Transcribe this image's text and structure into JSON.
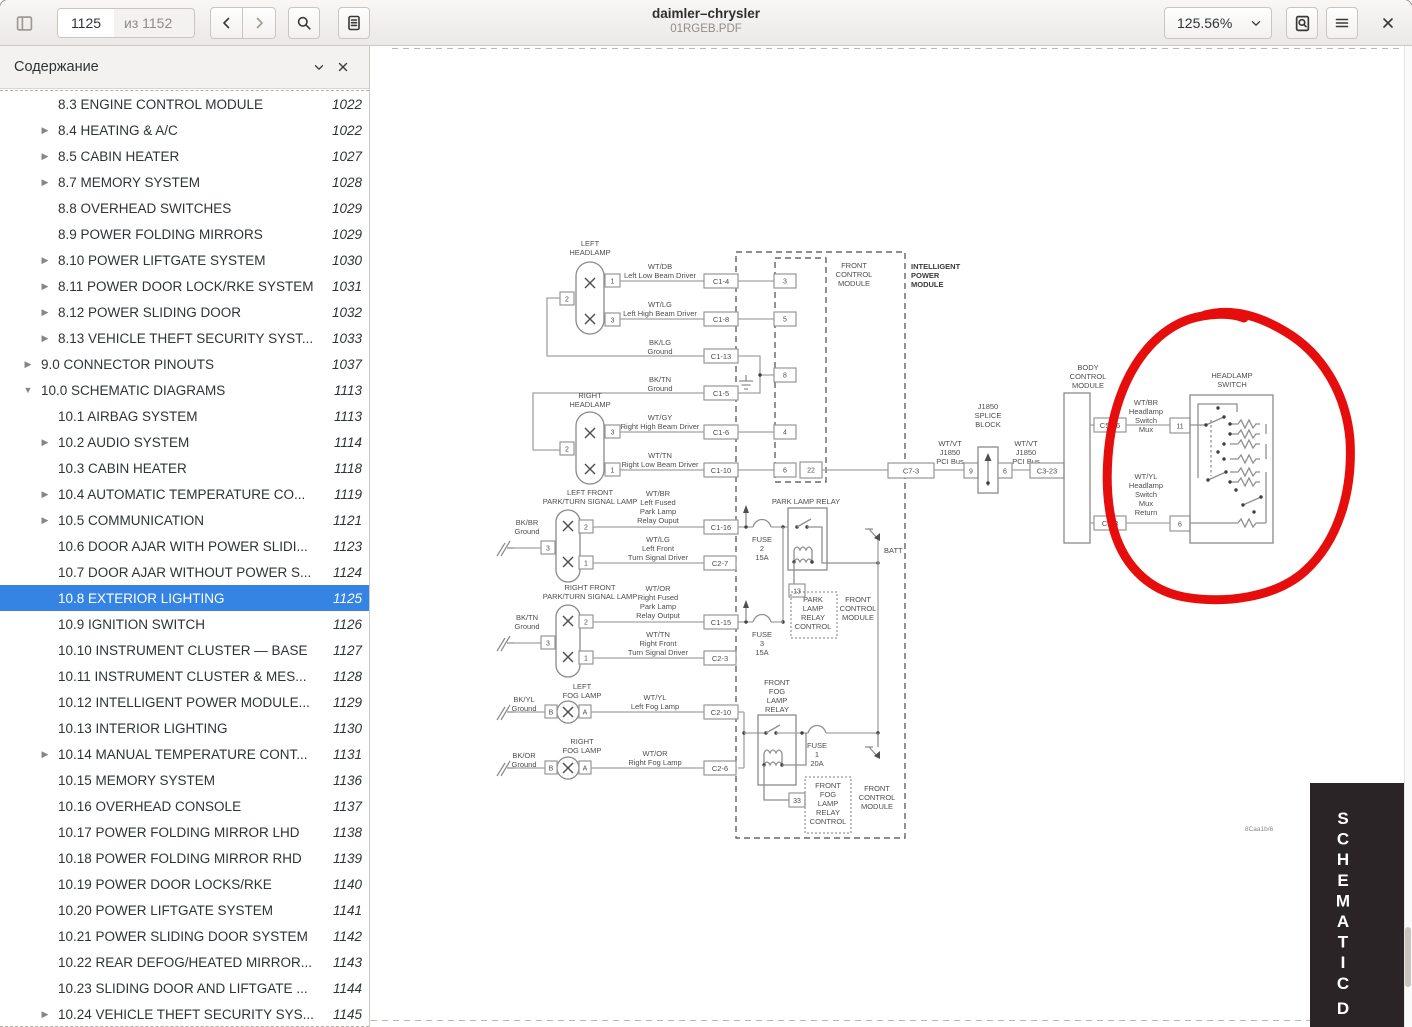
{
  "window": {
    "title": "daimler–chrysler",
    "subtitle": "01RGEB.PDF"
  },
  "toolbar": {
    "page_current": "1125",
    "page_total_label": "из 1152",
    "zoom_level": "125.56%"
  },
  "sidebar": {
    "header": "Содержание",
    "items": [
      {
        "label": "8.3 ENGINE CONTROL MODULE",
        "page": "1022",
        "exp": "none",
        "level": 2,
        "selected": false
      },
      {
        "label": "8.4 HEATING & A/C",
        "page": "1022",
        "exp": "right",
        "level": 2,
        "selected": false
      },
      {
        "label": "8.5 CABIN HEATER",
        "page": "1027",
        "exp": "right",
        "level": 2,
        "selected": false
      },
      {
        "label": "8.7 MEMORY SYSTEM",
        "page": "1028",
        "exp": "right",
        "level": 2,
        "selected": false
      },
      {
        "label": "8.8 OVERHEAD SWITCHES",
        "page": "1029",
        "exp": "none",
        "level": 2,
        "selected": false
      },
      {
        "label": "8.9 POWER FOLDING MIRRORS",
        "page": "1029",
        "exp": "none",
        "level": 2,
        "selected": false
      },
      {
        "label": "8.10 POWER LIFTGATE SYSTEM",
        "page": "1030",
        "exp": "right",
        "level": 2,
        "selected": false
      },
      {
        "label": "8.11 POWER DOOR LOCK/RKE SYSTEM",
        "page": "1031",
        "exp": "right",
        "level": 2,
        "selected": false
      },
      {
        "label": "8.12 POWER SLIDING DOOR",
        "page": "1032",
        "exp": "right",
        "level": 2,
        "selected": false
      },
      {
        "label": "8.13 VEHICLE THEFT SECURITY SYST...",
        "page": "1033",
        "exp": "right",
        "level": 2,
        "selected": false
      },
      {
        "label": "9.0 CONNECTOR PINOUTS",
        "page": "1037",
        "exp": "right",
        "level": 1,
        "selected": false
      },
      {
        "label": "10.0 SCHEMATIC DIAGRAMS",
        "page": "1113",
        "exp": "down",
        "level": 1,
        "selected": false
      },
      {
        "label": "10.1 AIRBAG SYSTEM",
        "page": "1113",
        "exp": "none",
        "level": 2,
        "selected": false
      },
      {
        "label": "10.2 AUDIO SYSTEM",
        "page": "1114",
        "exp": "right",
        "level": 2,
        "selected": false
      },
      {
        "label": "10.3 CABIN HEATER",
        "page": "1118",
        "exp": "none",
        "level": 2,
        "selected": false
      },
      {
        "label": "10.4 AUTOMATIC TEMPERATURE CO...",
        "page": "1119",
        "exp": "right",
        "level": 2,
        "selected": false
      },
      {
        "label": "10.5 COMMUNICATION",
        "page": "1121",
        "exp": "right",
        "level": 2,
        "selected": false
      },
      {
        "label": "10.6 DOOR AJAR WITH POWER SLIDI...",
        "page": "1123",
        "exp": "none",
        "level": 2,
        "selected": false
      },
      {
        "label": "10.7 DOOR AJAR WITHOUT POWER S...",
        "page": "1124",
        "exp": "none",
        "level": 2,
        "selected": false
      },
      {
        "label": "10.8 EXTERIOR LIGHTING",
        "page": "1125",
        "exp": "none",
        "level": 2,
        "selected": true
      },
      {
        "label": "10.9 IGNITION SWITCH",
        "page": "1126",
        "exp": "none",
        "level": 2,
        "selected": false
      },
      {
        "label": "10.10 INSTRUMENT CLUSTER — BASE",
        "page": "1127",
        "exp": "none",
        "level": 2,
        "selected": false
      },
      {
        "label": "10.11 INSTRUMENT CLUSTER & MES...",
        "page": "1128",
        "exp": "none",
        "level": 2,
        "selected": false
      },
      {
        "label": "10.12 INTELLIGENT POWER MODULE...",
        "page": "1129",
        "exp": "none",
        "level": 2,
        "selected": false
      },
      {
        "label": "10.13 INTERIOR LIGHTING",
        "page": "1130",
        "exp": "none",
        "level": 2,
        "selected": false
      },
      {
        "label": "10.14 MANUAL TEMPERATURE CONT...",
        "page": "1131",
        "exp": "right",
        "level": 2,
        "selected": false
      },
      {
        "label": "10.15 MEMORY SYSTEM",
        "page": "1136",
        "exp": "none",
        "level": 2,
        "selected": false
      },
      {
        "label": "10.16 OVERHEAD CONSOLE",
        "page": "1137",
        "exp": "none",
        "level": 2,
        "selected": false
      },
      {
        "label": "10.17 POWER FOLDING MIRROR LHD",
        "page": "1138",
        "exp": "none",
        "level": 2,
        "selected": false
      },
      {
        "label": "10.18 POWER FOLDING MIRROR RHD",
        "page": "1139",
        "exp": "none",
        "level": 2,
        "selected": false
      },
      {
        "label": "10.19 POWER DOOR LOCKS/RKE",
        "page": "1140",
        "exp": "none",
        "level": 2,
        "selected": false
      },
      {
        "label": "10.20 POWER LIFTGATE SYSTEM",
        "page": "1141",
        "exp": "none",
        "level": 2,
        "selected": false
      },
      {
        "label": "10.21 POWER SLIDING DOOR SYSTEM",
        "page": "1142",
        "exp": "none",
        "level": 2,
        "selected": false
      },
      {
        "label": "10.22 REAR DEFOG/HEATED MIRROR...",
        "page": "1143",
        "exp": "none",
        "level": 2,
        "selected": false
      },
      {
        "label": "10.23 SLIDING DOOR AND LIFTGATE ...",
        "page": "1144",
        "exp": "none",
        "level": 2,
        "selected": false
      },
      {
        "label": "10.24 VEHICLE THEFT SECURITY SYS...",
        "page": "1145",
        "exp": "right",
        "level": 2,
        "selected": false
      }
    ]
  },
  "tab": {
    "letters": [
      "S",
      "C",
      "H",
      "E",
      "M",
      "A",
      "T",
      "I",
      "C"
    ],
    "next_letter": "D"
  },
  "schematic": {
    "ref_code": "8Caa1b/6",
    "annotation_color": "#e60d0d",
    "left_headlamp": [
      "LEFT",
      "HEADLAMP"
    ],
    "right_headlamp": [
      "RIGHT",
      "HEADLAMP"
    ],
    "wt_db": [
      "WT/DB",
      "Left Low Beam Driver"
    ],
    "wt_lg_high": [
      "WT/LG",
      "Left High Beam Driver"
    ],
    "bk_lg_gnd": [
      "BK/LG",
      "Ground"
    ],
    "bk_tn_gnd": [
      "BK/TN",
      "Ground"
    ],
    "wt_gy": [
      "WT/GY",
      "Right High Beam Driver"
    ],
    "wt_tn_low": [
      "WT/TN",
      "Right Low Beam Driver"
    ],
    "lf_park_lamp": [
      "LEFT FRONT",
      "PARK/TURN SIGNAL LAMP"
    ],
    "rf_park_lamp": [
      "RIGHT FRONT",
      "PARK/TURN SIGNAL LAMP"
    ],
    "bk_br_gnd": [
      "BK/BR",
      "Ground"
    ],
    "wt_br_fused": [
      "WT/BR",
      "Left Fused",
      "Park Lamp",
      "Relay Ouput"
    ],
    "wt_lg_turn": [
      "WT/LG",
      "Left Front",
      "Turn Signal Driver"
    ],
    "wt_or_fused": [
      "WT/OR",
      "Right Fused",
      "Park Lamp",
      "Relay Output"
    ],
    "wt_tn_turn": [
      "WT/TN",
      "Right Front",
      "Turn Signal Driver"
    ],
    "left_fog": [
      "LEFT",
      "FOG LAMP"
    ],
    "right_fog": [
      "RIGHT",
      "FOG LAMP"
    ],
    "bk_yl_gnd": [
      "BK/YL",
      "Ground"
    ],
    "bk_or_gnd": [
      "BK/OR",
      "Ground"
    ],
    "wt_yl_fog": [
      "WT/YL",
      "Left Fog Lamp"
    ],
    "wt_or_fog": [
      "WT/OR",
      "Right Fog Lamp"
    ],
    "front_control_module": [
      "FRONT",
      "CONTROL",
      "MODULE"
    ],
    "intelligent_power_module": [
      "INTELLIGENT",
      "POWER",
      "MODULE"
    ],
    "park_lamp_relay": "PARK LAMP RELAY",
    "fuse2": [
      "FUSE",
      "2",
      "15A"
    ],
    "fuse3": [
      "FUSE",
      "3",
      "15A"
    ],
    "fuse1": [
      "FUSE",
      "1",
      "20A"
    ],
    "batt": "BATT",
    "park_lamp_relay_control": [
      "PARK",
      "LAMP",
      "RELAY",
      "CONTROL"
    ],
    "front_fog_lamp_relay": [
      "FRONT",
      "FOG",
      "LAMP",
      "RELAY"
    ],
    "front_fog_relay_control": [
      "FRONT",
      "FOG",
      "LAMP",
      "RELAY",
      "CONTROL"
    ],
    "j1850_splice": [
      "J1850",
      "SPLICE",
      "BLOCK"
    ],
    "wt_vt_pci": [
      "WT/VT",
      "J1850",
      "PCI Bus"
    ],
    "body_control_module": [
      "BODY",
      "CONTROL",
      "MODULE"
    ],
    "wt_br_mux": [
      "WT/BR",
      "Headlamp",
      "Switch",
      "Mux"
    ],
    "wt_yl_mux": [
      "WT/YL",
      "Headlamp",
      "Switch",
      "Mux",
      "Return"
    ],
    "headlamp_switch": [
      "HEADLAMP",
      "SWITCH"
    ],
    "connectors": {
      "c1_4": "C1-4",
      "c1_8": "C1-8",
      "c1_13": "C1-13",
      "c1_5": "C1-5",
      "c1_6": "C1-6",
      "c1_10": "C1-10",
      "c1_16": "C1-16",
      "c2_7": "C2-7",
      "c1_15": "C1-15",
      "c2_3": "C2-3",
      "c2_10": "C2-10",
      "c2_6": "C2-6",
      "c7_3": "C7-3",
      "c3_23": "C3-23",
      "c5_16": "C5-16",
      "c5_8": "C5-8"
    },
    "pins": {
      "p1": "1",
      "p2": "2",
      "p3": "3",
      "p4": "4",
      "p5": "5",
      "p6": "6",
      "p8": "8",
      "p9": "9",
      "p11": "11",
      "p13": "13",
      "p22": "22",
      "p33": "33",
      "pB": "B",
      "pA": "A"
    }
  }
}
